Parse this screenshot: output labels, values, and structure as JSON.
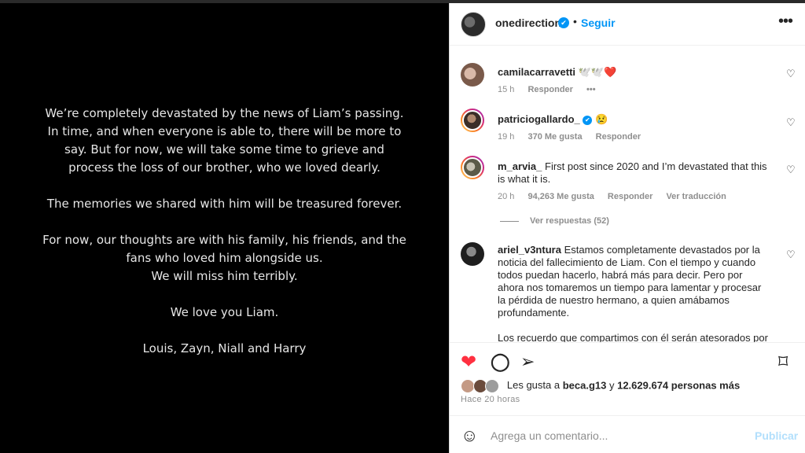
{
  "post_image": {
    "statement_paragraphs": [
      [
        "We’re completely devastated by the news of Liam’s passing.",
        "In time, and when everyone is able to, there will be more to",
        "say. But for now, we will take some time to grieve and",
        "process the loss of our brother, who we loved dearly."
      ],
      [
        "The memories we shared with him will be treasured forever."
      ],
      [
        "For now, our thoughts are with his family, his friends, and the",
        "fans who loved him alongside us.",
        "We will miss him terribly."
      ],
      [
        "We love you Liam."
      ],
      [
        "Louis, Zayn, Niall and Harry"
      ]
    ]
  },
  "header": {
    "username": "onedirection",
    "verified_icon": "✔",
    "separator": "•",
    "follow_label": "Seguir",
    "more_icon": "•••"
  },
  "comments": [
    {
      "username": "camilacarravetti",
      "text": "🕊️🕊️❤️",
      "time": "15 h",
      "likes": "",
      "reply": "Responder",
      "extra": "•••",
      "translate": ""
    },
    {
      "username": "patriciogallardo_",
      "verified_icon": "✔",
      "text": "😢",
      "time": "19 h",
      "likes": "370 Me gusta",
      "reply": "Responder",
      "translate": ""
    },
    {
      "username": "m_arvia_",
      "text": "First post since 2020 and I’m devastated that this is what it is.",
      "time": "20 h",
      "likes": "94,263 Me gusta",
      "reply": "Responder",
      "translate": "Ver traducción",
      "view_replies": "Ver respuestas (52)"
    },
    {
      "username": "ariel_v3ntura",
      "text": "Estamos completamente devastados por la noticia del fallecimiento de Liam. Con el tiempo y cuando todos puedan hacerlo, habrá más para decir. Pero por ahora nos tomaremos un tiempo para lamentar y procesar la pérdida de nuestro hermano, a quien amábamos profundamente.",
      "text2": "Los recuerdo que compartimos con él serán atesorados por"
    }
  ],
  "actions": {
    "like_icon": "❤",
    "comment_icon": "◯",
    "share_icon": "➢",
    "save_icon": "⌑",
    "small_heart_icon": "♡"
  },
  "likes": {
    "prefix": "Les gusta a ",
    "user": "beca.g13",
    "middle": " y ",
    "count": "12.629.674 personas más"
  },
  "time_ago": "Hace 20 horas",
  "add_comment": {
    "emoji_icon": "☺",
    "placeholder": "Agrega un comentario...",
    "publish_label": "Publicar"
  },
  "colors": {
    "accent": "#0095f6",
    "like_red": "#ff3040",
    "muted": "#8e8e8e",
    "publish_disabled": "#b2dffc"
  }
}
